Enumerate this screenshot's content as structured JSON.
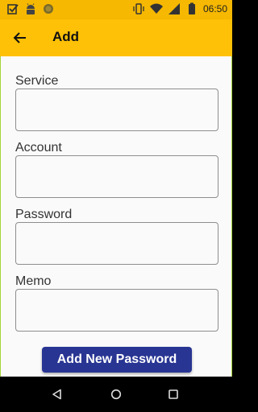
{
  "status_bar": {
    "time": "06:50",
    "icons": [
      "checkbox-notification-icon",
      "android-icon",
      "circle-notification-icon",
      "vibrate-icon",
      "wifi-icon",
      "signal-icon",
      "battery-icon"
    ]
  },
  "app_bar": {
    "title": "Add",
    "back_icon": "arrow-back-icon",
    "background": "#ffc107"
  },
  "form": {
    "fields": [
      {
        "label": "Service",
        "value": "",
        "placeholder": ""
      },
      {
        "label": "Account",
        "value": "",
        "placeholder": ""
      },
      {
        "label": "Password",
        "value": "",
        "placeholder": ""
      },
      {
        "label": "Memo",
        "value": "",
        "placeholder": ""
      }
    ],
    "submit_label": "Add New Password",
    "submit_color": "#283593"
  },
  "nav_bar": {
    "buttons": [
      "back-triangle-icon",
      "home-circle-icon",
      "recents-square-icon"
    ]
  }
}
